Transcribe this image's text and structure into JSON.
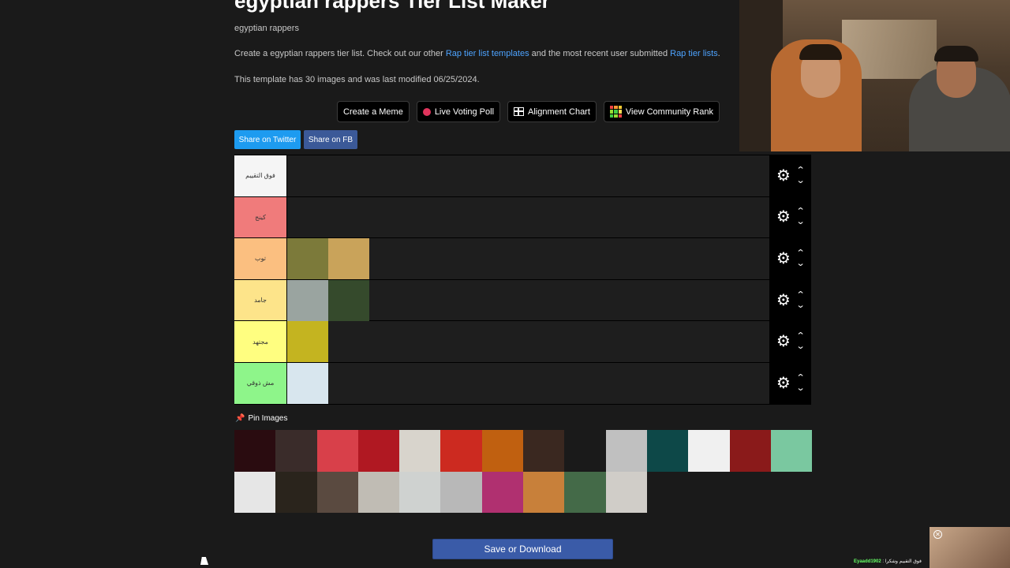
{
  "page": {
    "title": "egyptian rappers Tier List Maker",
    "subtitle": "egyptian rappers",
    "desc_prefix": "Create a egyptian rappers tier list. Check out our other ",
    "desc_link1": "Rap tier list templates",
    "desc_middle": " and the most recent user submitted ",
    "desc_link2": "Rap tier lists",
    "desc_suffix": ".",
    "meta": "This template has 30 images and was last modified 06/25/2024."
  },
  "toolbar": {
    "meme": "Create a Meme",
    "poll": "Live Voting Poll",
    "alignment": "Alignment Chart",
    "community": "View Community Rank"
  },
  "share": {
    "twitter": "Share on Twitter",
    "fb": "Share on FB"
  },
  "tiers": [
    {
      "label": "فوق التقييم",
      "color": "#f5f5f5",
      "images": []
    },
    {
      "label": "كينج",
      "color": "#f07b7b",
      "images": []
    },
    {
      "label": "توب",
      "color": "#fbbf80",
      "images": [
        "#7c7a3a",
        "#c9a35a"
      ]
    },
    {
      "label": "جامد",
      "color": "#fde48a",
      "images": [
        "#9aa4a0",
        "#354a2c"
      ]
    },
    {
      "label": "مجتهد",
      "color": "#fffe80",
      "images": [
        "#c4b420"
      ]
    },
    {
      "label": "مش ذوقي",
      "color": "#8ef58a",
      "images": [
        "#d8e6ee"
      ]
    }
  ],
  "pin_label": "Pin Images",
  "pool_images": [
    "#2a0c10",
    "#3a2c2a",
    "#d8404a",
    "#b01822",
    "#d8d4cc",
    "#cc2a20",
    "#c06010",
    "#3a2820",
    "#1a1a1a",
    "#c0c0c0",
    "#0d4848",
    "#f0f0f0",
    "#8a1a1a",
    "#7ac8a0",
    "#e6e6e6",
    "#2a241c",
    "#5a4a40",
    "#c0bcb4",
    "#cfd2d0",
    "#b8b8b8",
    "#b03070",
    "#c8803a",
    "#446a48",
    "#d0cdc8"
  ],
  "save_label": "Save or Download",
  "overlay": {
    "ticker_user": "Eyaadd1902",
    "ticker_text": " : فوق التقييم وشكرا"
  },
  "colors": {
    "twitter": "#1d9bf0",
    "facebook": "#3b5998",
    "save": "#3a5ba8",
    "link": "#4da3ff"
  }
}
